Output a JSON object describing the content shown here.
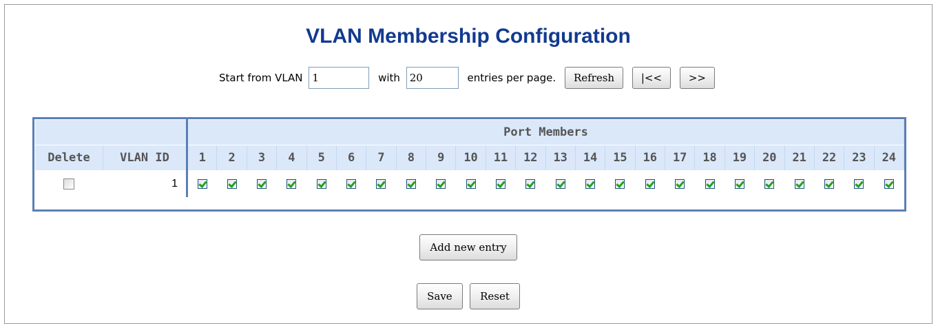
{
  "page": {
    "title": "VLAN Membership Configuration"
  },
  "controls": {
    "start_label": "Start from VLAN",
    "start_value": "1",
    "with_label": "with",
    "entries_value": "20",
    "entries_label": "entries per page.",
    "refresh_label": "Refresh",
    "prev_label": "|<<",
    "next_label": ">>"
  },
  "table": {
    "group_header": "Port Members",
    "delete_header": "Delete",
    "vlanid_header": "VLAN ID",
    "ports": [
      "1",
      "2",
      "3",
      "4",
      "5",
      "6",
      "7",
      "8",
      "9",
      "10",
      "11",
      "12",
      "13",
      "14",
      "15",
      "16",
      "17",
      "18",
      "19",
      "20",
      "21",
      "22",
      "23",
      "24"
    ],
    "rows": [
      {
        "delete": false,
        "vlan_id": "1",
        "members": [
          true,
          true,
          true,
          true,
          true,
          true,
          true,
          true,
          true,
          true,
          true,
          true,
          true,
          true,
          true,
          true,
          true,
          true,
          true,
          true,
          true,
          true,
          true,
          true
        ]
      }
    ]
  },
  "actions": {
    "add_label": "Add new entry",
    "save_label": "Save",
    "reset_label": "Reset"
  },
  "colors": {
    "title": "#123a8f",
    "header_bg": "#dbe8fa",
    "table_border": "#5a7fb3",
    "check": "#21a121"
  }
}
